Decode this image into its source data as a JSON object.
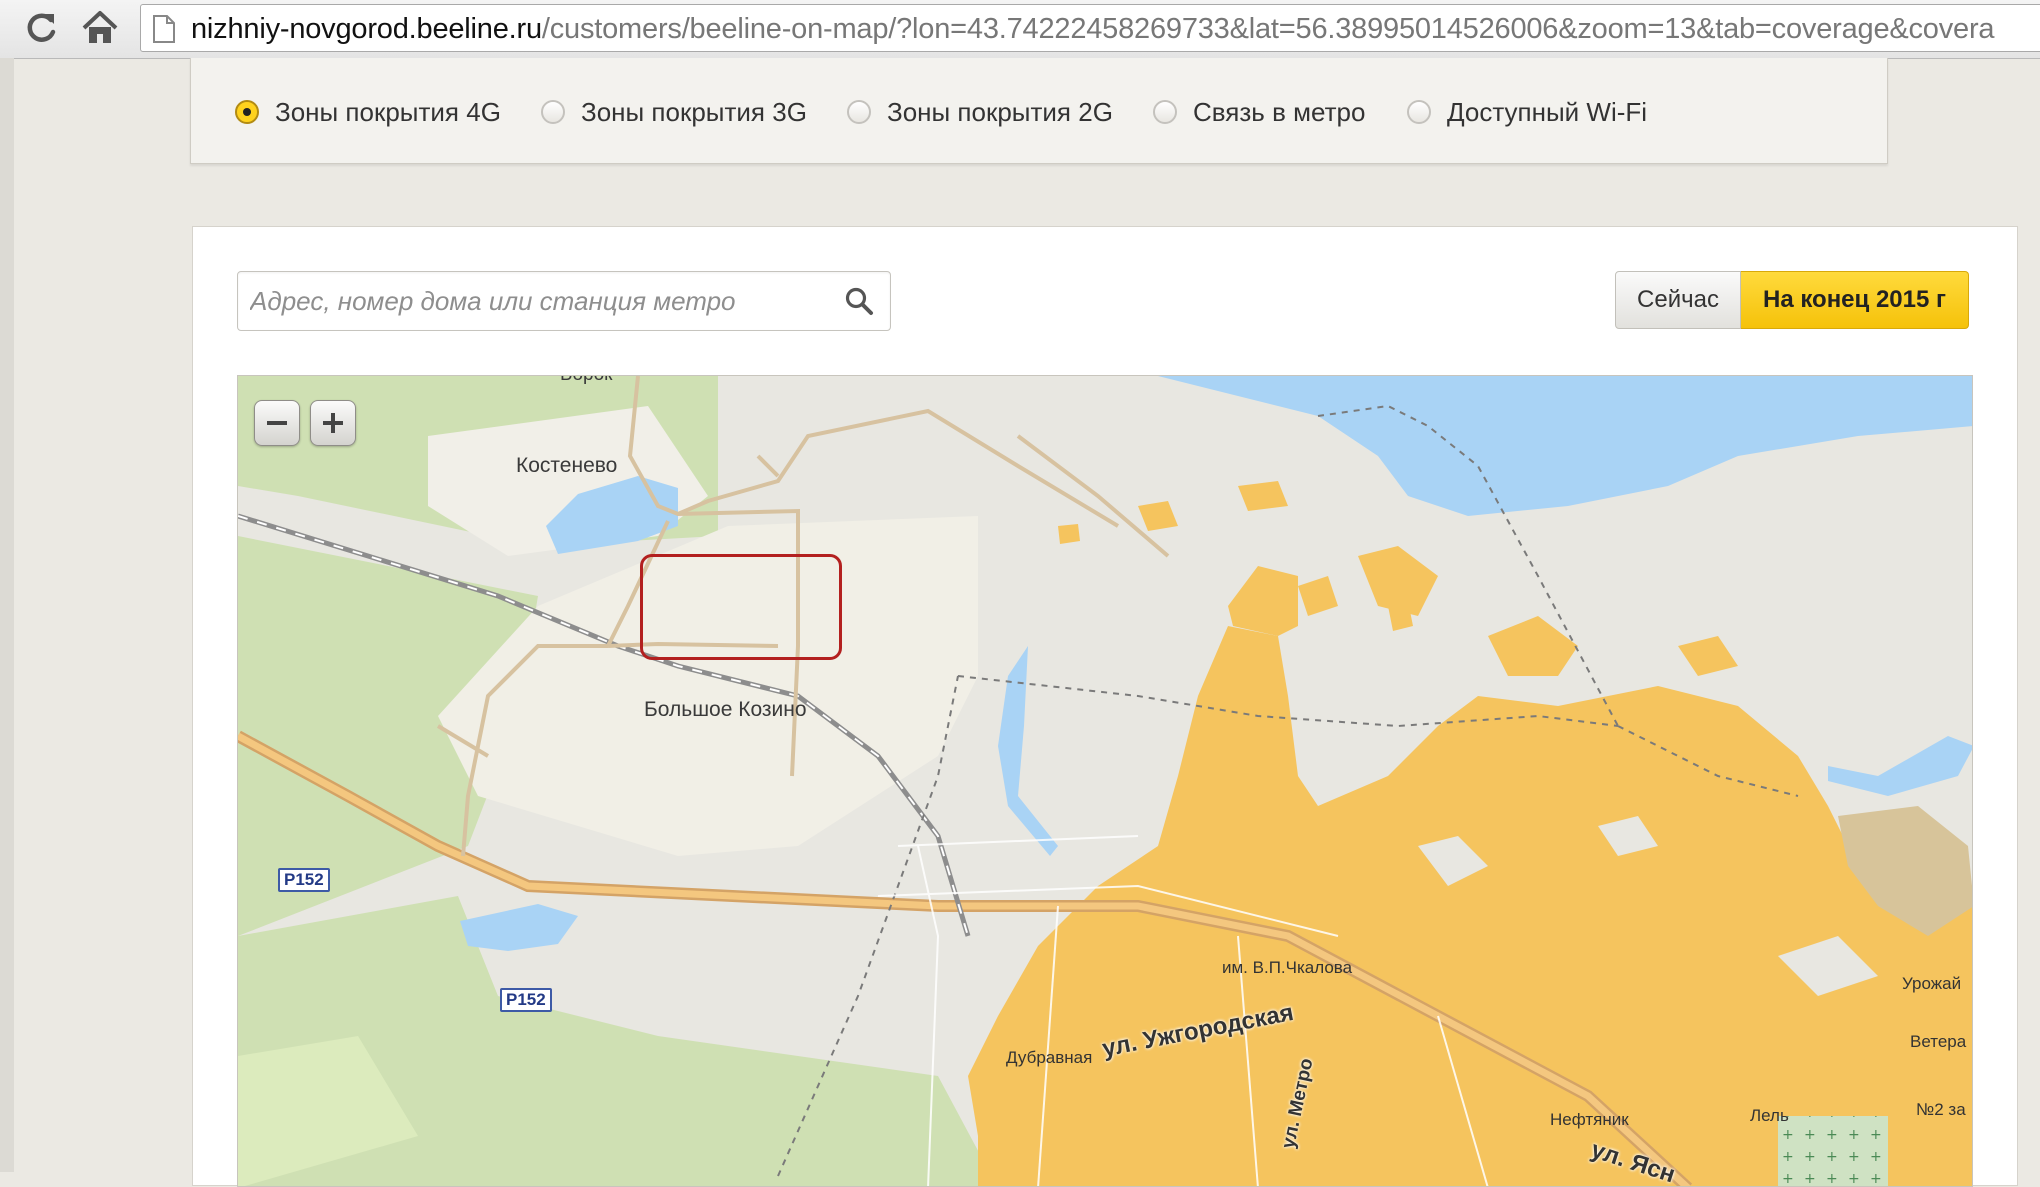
{
  "browser": {
    "url_host": "nizhniy-novgorod.beeline.ru",
    "url_path": "/customers/beeline-on-map/?lon=43.74222458269733&lat=56.38995014526006&zoom=13&tab=coverage&covera"
  },
  "coverage_tabs": [
    {
      "label": "Зоны покрытия 4G",
      "checked": true
    },
    {
      "label": "Зоны покрытия 3G",
      "checked": false
    },
    {
      "label": "Зоны покрытия 2G",
      "checked": false
    },
    {
      "label": "Связь в метро",
      "checked": false
    },
    {
      "label": "Доступный Wi-Fi",
      "checked": false
    }
  ],
  "search": {
    "placeholder": "Адрес, номер дома или станция метро",
    "value": ""
  },
  "period_toggle": {
    "now_label": "Сейчас",
    "end2015_label": "На конец 2015 г",
    "active": "end2015"
  },
  "map": {
    "labels": {
      "borok": "Борок",
      "kostenevo": "Костенево",
      "bolshoe_kozino": "Большое Козино",
      "road_p152_a": "Р152",
      "road_p152_b": "Р152",
      "chkalova": "им. В.П.Чкалова",
      "dubravnaya": "Дубравная",
      "uzhgorodskaya": "ул. Ужгородская",
      "metro_street": "ул. Метро",
      "neftyanik": "Нефтяник",
      "lel": "Лель",
      "urozhai": "Урожай",
      "vetera": "Ветера",
      "no2": "№2 за",
      "yasnaya": "ул. Ясн"
    },
    "colors": {
      "coverage": "#f5c45e",
      "water": "#a9d3f5",
      "forest": "#cddfaa",
      "settlement": "#f1efe6",
      "highlight": "#b3201f"
    }
  }
}
